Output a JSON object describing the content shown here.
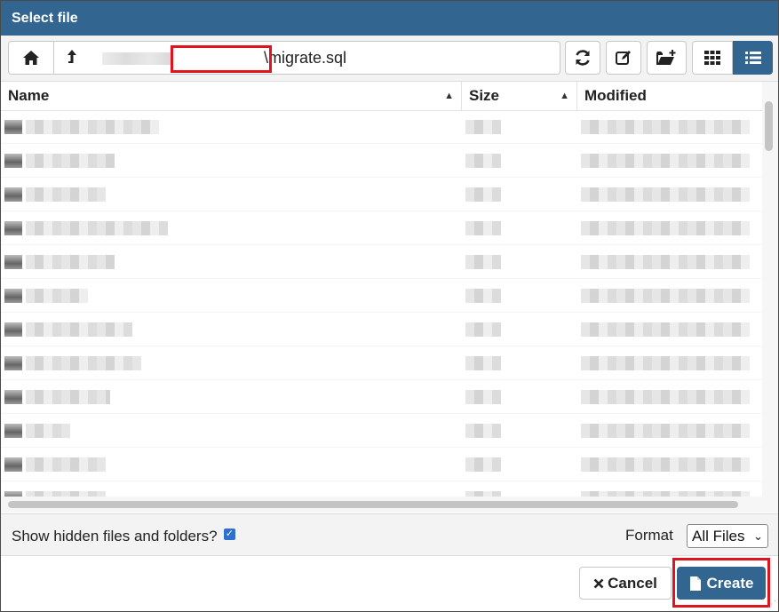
{
  "dialog": {
    "title": "Select file"
  },
  "toolbar": {
    "path_value": "\\migrate.sql"
  },
  "table": {
    "columns": [
      {
        "label": "Name"
      },
      {
        "label": "Size"
      },
      {
        "label": "Modified"
      }
    ],
    "row_count": 12
  },
  "footer": {
    "show_hidden_label": "Show hidden files and folders?",
    "show_hidden_checked": true,
    "format_label": "Format",
    "format_selected": "All Files",
    "cancel_label": "Cancel",
    "create_label": "Create"
  },
  "icons": [
    "home-icon",
    "arrow-up-icon",
    "refresh-icon",
    "edit-icon",
    "new-folder-icon",
    "grid-view-icon",
    "list-view-icon",
    "times-icon",
    "file-icon"
  ],
  "colors": {
    "header_bar": "#326690",
    "highlight": "#e0141e",
    "checkbox": "#2f6fd1"
  }
}
